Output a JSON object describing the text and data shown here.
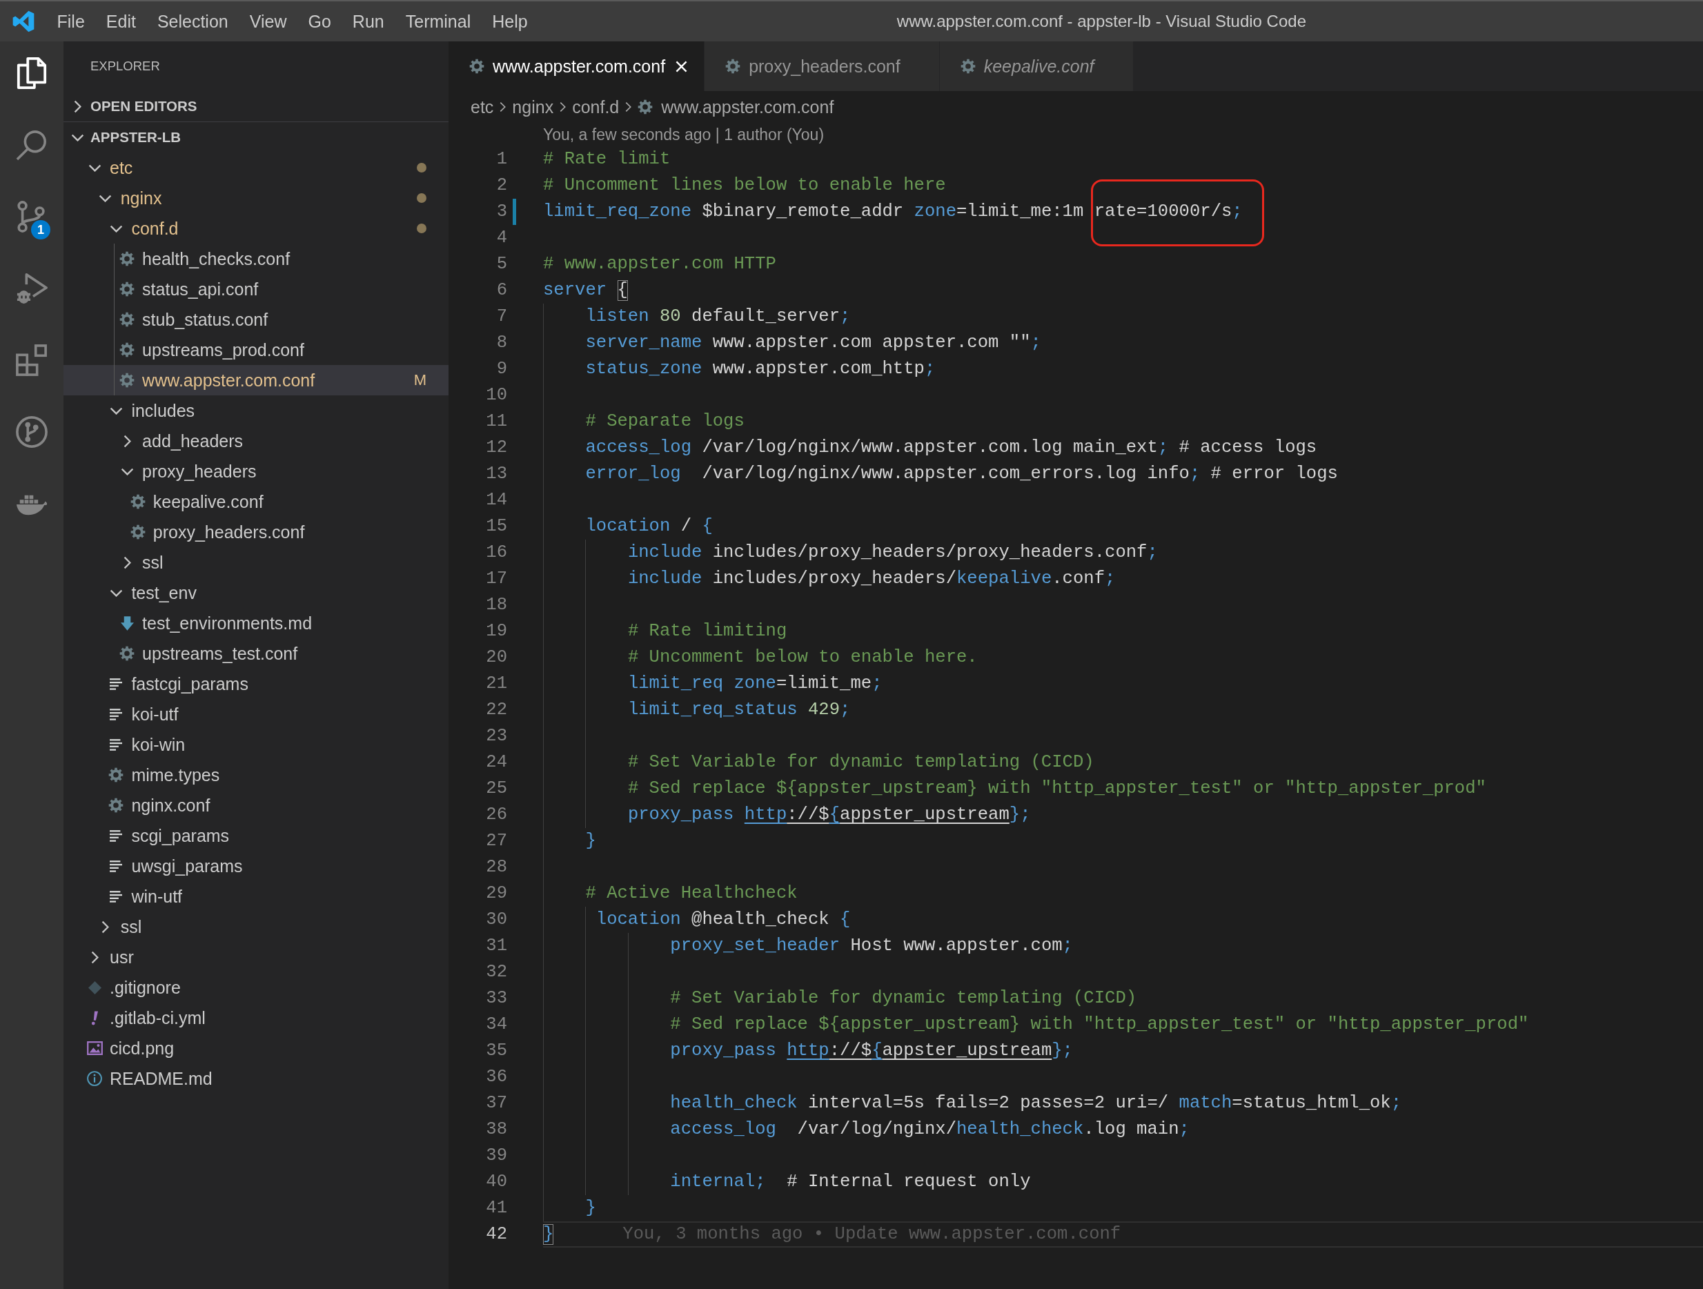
{
  "title_bar": {
    "menu": [
      "File",
      "Edit",
      "Selection",
      "View",
      "Go",
      "Run",
      "Terminal",
      "Help"
    ],
    "title": "www.appster.com.conf - appster-lb - Visual Studio Code"
  },
  "activity_bar": [
    {
      "kind": "files",
      "selected": true
    },
    {
      "kind": "search",
      "selected": false
    },
    {
      "kind": "source-control",
      "selected": false,
      "badge": "1"
    },
    {
      "kind": "run-debug",
      "selected": false
    },
    {
      "kind": "extensions",
      "selected": false
    },
    {
      "kind": "branch-circle",
      "selected": false
    },
    {
      "kind": "containers",
      "selected": false
    }
  ],
  "explorer": {
    "title": "EXPLORER",
    "sections": [
      {
        "label": "OPEN EDITORS",
        "expanded": false
      },
      {
        "label": "APPSTER-LB",
        "expanded": true,
        "items": [
          {
            "name": "etc",
            "kind": "folder",
            "expanded": true,
            "selected": false,
            "modified": true,
            "children": [
              {
                "name": "nginx",
                "kind": "folder",
                "expanded": true,
                "selected": false,
                "modified": true,
                "children": [
                  {
                    "name": "conf.d",
                    "kind": "folder",
                    "expanded": true,
                    "selected": false,
                    "modified": true,
                    "children": [
                      {
                        "name": "health_checks.conf",
                        "kind": "config",
                        "selected": false,
                        "modified": false
                      },
                      {
                        "name": "status_api.conf",
                        "kind": "config",
                        "selected": false,
                        "modified": false
                      },
                      {
                        "name": "stub_status.conf",
                        "kind": "config",
                        "selected": false,
                        "modified": false
                      },
                      {
                        "name": "upstreams_prod.conf",
                        "kind": "config",
                        "selected": false,
                        "modified": false
                      },
                      {
                        "name": "www.appster.com.conf",
                        "kind": "config",
                        "selected": true,
                        "modified": true,
                        "badge": "M"
                      }
                    ]
                  },
                  {
                    "name": "includes",
                    "kind": "folder",
                    "expanded": true,
                    "selected": false,
                    "modified": false,
                    "children": [
                      {
                        "name": "add_headers",
                        "kind": "folder",
                        "expanded": false,
                        "selected": false,
                        "modified": false
                      },
                      {
                        "name": "proxy_headers",
                        "kind": "folder",
                        "expanded": true,
                        "selected": false,
                        "modified": false,
                        "children": [
                          {
                            "name": "keepalive.conf",
                            "kind": "config",
                            "selected": false,
                            "modified": false
                          },
                          {
                            "name": "proxy_headers.conf",
                            "kind": "config",
                            "selected": false,
                            "modified": false
                          }
                        ]
                      },
                      {
                        "name": "ssl",
                        "kind": "folder",
                        "expanded": false,
                        "selected": false,
                        "modified": false
                      }
                    ]
                  },
                  {
                    "name": "test_env",
                    "kind": "folder",
                    "expanded": true,
                    "selected": false,
                    "modified": false,
                    "children": [
                      {
                        "name": "test_environments.md",
                        "kind": "markdown",
                        "selected": false,
                        "modified": false
                      },
                      {
                        "name": "upstreams_test.conf",
                        "kind": "config",
                        "selected": false,
                        "modified": false
                      }
                    ]
                  },
                  {
                    "name": "fastcgi_params",
                    "kind": "plain",
                    "selected": false,
                    "modified": false
                  },
                  {
                    "name": "koi-utf",
                    "kind": "plain",
                    "selected": false,
                    "modified": false
                  },
                  {
                    "name": "koi-win",
                    "kind": "plain",
                    "selected": false,
                    "modified": false
                  },
                  {
                    "name": "mime.types",
                    "kind": "config",
                    "selected": false,
                    "modified": false
                  },
                  {
                    "name": "nginx.conf",
                    "kind": "config",
                    "selected": false,
                    "modified": false
                  },
                  {
                    "name": "scgi_params",
                    "kind": "plain",
                    "selected": false,
                    "modified": false
                  },
                  {
                    "name": "uwsgi_params",
                    "kind": "plain",
                    "selected": false,
                    "modified": false
                  },
                  {
                    "name": "win-utf",
                    "kind": "plain",
                    "selected": false,
                    "modified": false
                  }
                ]
              },
              {
                "name": "ssl",
                "kind": "folder",
                "expanded": false,
                "selected": false,
                "modified": false
              }
            ]
          },
          {
            "name": "usr",
            "kind": "folder",
            "expanded": false,
            "selected": false,
            "modified": false
          },
          {
            "name": ".gitignore",
            "kind": "git",
            "selected": false,
            "modified": false
          },
          {
            "name": ".gitlab-ci.yml",
            "kind": "yaml",
            "selected": false,
            "modified": false
          },
          {
            "name": "cicd.png",
            "kind": "image",
            "selected": false,
            "modified": false
          },
          {
            "name": "README.md",
            "kind": "info",
            "selected": false,
            "modified": false
          }
        ]
      }
    ]
  },
  "tabs": [
    {
      "label": "www.appster.com.conf",
      "selected": true,
      "preview": false
    },
    {
      "label": "proxy_headers.conf",
      "selected": false,
      "preview": false
    },
    {
      "label": "keepalive.conf",
      "selected": false,
      "preview": true
    }
  ],
  "breadcrumb": [
    {
      "label": "etc",
      "kind": "folder"
    },
    {
      "label": "nginx",
      "kind": "folder"
    },
    {
      "label": "conf.d",
      "kind": "folder"
    },
    {
      "label": "www.appster.com.conf",
      "kind": "config"
    }
  ],
  "editor": {
    "codelens": "You, a few seconds ago | 1 author (You)",
    "lines": [
      {
        "n": "1",
        "changed": false,
        "current": false,
        "tokens": [
          {
            "text": "# Rate limit",
            "kind": "comment"
          }
        ]
      },
      {
        "n": "2",
        "changed": false,
        "current": false,
        "tokens": [
          {
            "text": "# Uncomment lines below to enable here",
            "kind": "comment"
          }
        ]
      },
      {
        "n": "3",
        "changed": true,
        "current": false,
        "tokens": [
          {
            "text": "limit_req_zone",
            "kind": "keyword"
          },
          {
            "text": " $binary_remote_addr ",
            "kind": "plain"
          },
          {
            "text": "zone",
            "kind": "keyword"
          },
          {
            "text": "=limit_me:1m ",
            "kind": "plain"
          },
          {
            "kind": "circled",
            "tokens": [
              {
                "text": "rate=10000r/s",
                "kind": "plain"
              },
              {
                "text": ";",
                "kind": "keyword"
              }
            ]
          }
        ]
      },
      {
        "n": "4",
        "changed": false,
        "current": false
      },
      {
        "n": "5",
        "changed": false,
        "current": false,
        "tokens": [
          {
            "text": "# www.appster.com HTTP",
            "kind": "comment"
          }
        ]
      },
      {
        "n": "6",
        "changed": false,
        "current": false,
        "tokens": [
          {
            "text": "server ",
            "kind": "keyword"
          },
          {
            "text": "{",
            "kind": "match-plain"
          }
        ]
      },
      {
        "n": "7",
        "changed": false,
        "current": false,
        "tokens": [
          {
            "text": "    listen",
            "kind": "keyword"
          },
          {
            "text": " 80",
            "kind": "number"
          },
          {
            "text": " default_server",
            "kind": "plain"
          },
          {
            "text": ";",
            "kind": "keyword"
          }
        ]
      },
      {
        "n": "8",
        "changed": false,
        "current": false,
        "tokens": [
          {
            "text": "    server_name",
            "kind": "keyword"
          },
          {
            "text": " www.appster.com appster.com \"\"",
            "kind": "plain"
          },
          {
            "text": ";",
            "kind": "keyword"
          }
        ]
      },
      {
        "n": "9",
        "changed": false,
        "current": false,
        "tokens": [
          {
            "text": "    status_zone",
            "kind": "keyword"
          },
          {
            "text": " www.appster.com_http",
            "kind": "plain"
          },
          {
            "text": ";",
            "kind": "keyword"
          }
        ]
      },
      {
        "n": "10",
        "changed": false,
        "current": false
      },
      {
        "n": "11",
        "changed": false,
        "current": false,
        "tokens": [
          {
            "text": "    # Separate logs",
            "kind": "comment"
          }
        ]
      },
      {
        "n": "12",
        "changed": false,
        "current": false,
        "tokens": [
          {
            "text": "    access_log",
            "kind": "keyword"
          },
          {
            "text": " /var/log/nginx/www.appster.com.log main_ext",
            "kind": "plain"
          },
          {
            "text": ";",
            "kind": "keyword"
          },
          {
            "text": " # access logs",
            "kind": "plain"
          }
        ]
      },
      {
        "n": "13",
        "changed": false,
        "current": false,
        "tokens": [
          {
            "text": "    error_log",
            "kind": "keyword"
          },
          {
            "text": "  /var/log/nginx/www.appster.com_errors.log info",
            "kind": "plain"
          },
          {
            "text": ";",
            "kind": "keyword"
          },
          {
            "text": " # error logs",
            "kind": "plain"
          }
        ]
      },
      {
        "n": "14",
        "changed": false,
        "current": false
      },
      {
        "n": "15",
        "changed": false,
        "current": false,
        "tokens": [
          {
            "text": "    location",
            "kind": "keyword"
          },
          {
            "text": " / ",
            "kind": "plain"
          },
          {
            "text": "{",
            "kind": "keyword"
          }
        ]
      },
      {
        "n": "16",
        "changed": false,
        "current": false,
        "tokens": [
          {
            "text": "        include",
            "kind": "keyword"
          },
          {
            "text": " includes/proxy_headers/proxy_headers.conf",
            "kind": "plain"
          },
          {
            "text": ";",
            "kind": "keyword"
          }
        ]
      },
      {
        "n": "17",
        "changed": false,
        "current": false,
        "tokens": [
          {
            "text": "        include",
            "kind": "keyword"
          },
          {
            "text": " includes/proxy_headers/",
            "kind": "plain"
          },
          {
            "text": "keepalive",
            "kind": "keyword"
          },
          {
            "text": ".conf",
            "kind": "plain"
          },
          {
            "text": ";",
            "kind": "keyword"
          }
        ]
      },
      {
        "n": "18",
        "changed": false,
        "current": false
      },
      {
        "n": "19",
        "changed": false,
        "current": false,
        "tokens": [
          {
            "text": "        # Rate limiting",
            "kind": "comment"
          }
        ]
      },
      {
        "n": "20",
        "changed": false,
        "current": false,
        "tokens": [
          {
            "text": "        # Uncomment below to enable here.",
            "kind": "comment"
          }
        ]
      },
      {
        "n": "21",
        "changed": false,
        "current": false,
        "tokens": [
          {
            "text": "        limit_req zone",
            "kind": "keyword"
          },
          {
            "text": "=limit_me",
            "kind": "plain"
          },
          {
            "text": ";",
            "kind": "keyword"
          }
        ]
      },
      {
        "n": "22",
        "changed": false,
        "current": false,
        "tokens": [
          {
            "text": "        limit_req_status",
            "kind": "keyword"
          },
          {
            "text": " 429",
            "kind": "number"
          },
          {
            "text": ";",
            "kind": "keyword"
          }
        ]
      },
      {
        "n": "23",
        "changed": false,
        "current": false
      },
      {
        "n": "24",
        "changed": false,
        "current": false,
        "tokens": [
          {
            "text": "        # Set Variable for dynamic templating (CICD)",
            "kind": "comment"
          }
        ]
      },
      {
        "n": "25",
        "changed": false,
        "current": false,
        "tokens": [
          {
            "text": "        # Sed replace ${appster_upstream} with \"http_appster_test\" or \"http_appster_prod\"",
            "kind": "comment"
          }
        ]
      },
      {
        "n": "26",
        "changed": false,
        "current": false,
        "tokens": [
          {
            "text": "        proxy_pass ",
            "kind": "keyword"
          },
          {
            "text": "http",
            "kind": "link-keyword"
          },
          {
            "text": "://$",
            "kind": "link-plain"
          },
          {
            "text": "{",
            "kind": "link-keyword"
          },
          {
            "text": "appster_upstream",
            "kind": "link-plain"
          },
          {
            "text": "}",
            "kind": "keyword"
          },
          {
            "text": ";",
            "kind": "keyword"
          }
        ]
      },
      {
        "n": "27",
        "changed": false,
        "current": false,
        "tokens": [
          {
            "text": "    }",
            "kind": "keyword"
          }
        ]
      },
      {
        "n": "28",
        "changed": false,
        "current": false
      },
      {
        "n": "29",
        "changed": false,
        "current": false,
        "tokens": [
          {
            "text": "    # Active Healthcheck",
            "kind": "comment"
          }
        ]
      },
      {
        "n": "30",
        "changed": false,
        "current": false,
        "tokens": [
          {
            "text": "     location",
            "kind": "keyword"
          },
          {
            "text": " @health_check ",
            "kind": "plain"
          },
          {
            "text": "{",
            "kind": "keyword"
          }
        ]
      },
      {
        "n": "31",
        "changed": false,
        "current": false,
        "tokens": [
          {
            "text": "            proxy_set_header",
            "kind": "keyword"
          },
          {
            "text": " Host www.appster.com",
            "kind": "plain"
          },
          {
            "text": ";",
            "kind": "keyword"
          }
        ]
      },
      {
        "n": "32",
        "changed": false,
        "current": false
      },
      {
        "n": "33",
        "changed": false,
        "current": false,
        "tokens": [
          {
            "text": "            # Set Variable for dynamic templating (CICD)",
            "kind": "comment"
          }
        ]
      },
      {
        "n": "34",
        "changed": false,
        "current": false,
        "tokens": [
          {
            "text": "            # Sed replace ${appster_upstream} with \"http_appster_test\" or \"http_appster_prod\"",
            "kind": "comment"
          }
        ]
      },
      {
        "n": "35",
        "changed": false,
        "current": false,
        "tokens": [
          {
            "text": "            proxy_pass ",
            "kind": "keyword"
          },
          {
            "text": "http",
            "kind": "link-keyword"
          },
          {
            "text": "://$",
            "kind": "link-plain"
          },
          {
            "text": "{",
            "kind": "link-keyword"
          },
          {
            "text": "appster_upstream",
            "kind": "link-plain"
          },
          {
            "text": "}",
            "kind": "keyword"
          },
          {
            "text": ";",
            "kind": "keyword"
          }
        ]
      },
      {
        "n": "36",
        "changed": false,
        "current": false
      },
      {
        "n": "37",
        "changed": false,
        "current": false,
        "tokens": [
          {
            "text": "            health_check",
            "kind": "keyword"
          },
          {
            "text": " interval=5s fails=2 passes=2 uri=/ ",
            "kind": "plain"
          },
          {
            "text": "match",
            "kind": "keyword"
          },
          {
            "text": "=status_html_ok",
            "kind": "plain"
          },
          {
            "text": ";",
            "kind": "keyword"
          }
        ]
      },
      {
        "n": "38",
        "changed": false,
        "current": false,
        "tokens": [
          {
            "text": "            access_log",
            "kind": "keyword"
          },
          {
            "text": "  /var/log/nginx/",
            "kind": "plain"
          },
          {
            "text": "health_check",
            "kind": "keyword"
          },
          {
            "text": ".log main",
            "kind": "plain"
          },
          {
            "text": ";",
            "kind": "keyword"
          }
        ]
      },
      {
        "n": "39",
        "changed": false,
        "current": false
      },
      {
        "n": "40",
        "changed": false,
        "current": false,
        "tokens": [
          {
            "text": "            internal",
            "kind": "keyword"
          },
          {
            "text": ";",
            "kind": "keyword"
          },
          {
            "text": "  # Internal request only",
            "kind": "plain"
          }
        ]
      },
      {
        "n": "41",
        "changed": false,
        "current": false,
        "tokens": [
          {
            "text": "    }",
            "kind": "keyword"
          }
        ]
      },
      {
        "n": "42",
        "changed": false,
        "current": true,
        "tokens": [
          {
            "text": "}",
            "kind": "match-keyword"
          }
        ],
        "blame": "You, 3 months ago • Update www.appster.com.conf"
      }
    ]
  }
}
